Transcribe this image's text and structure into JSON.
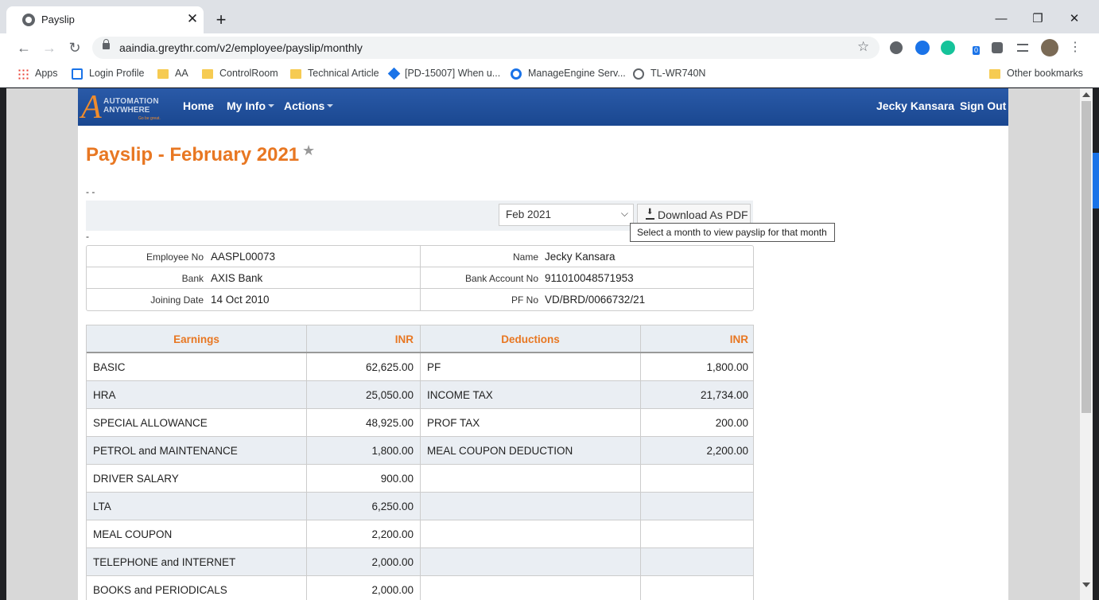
{
  "browser": {
    "tab_title": "Payslip",
    "tab_close": "✕",
    "new_tab": "+",
    "url": "aaindia.greythr.com/v2/employee/payslip/monthly",
    "window_controls": {
      "minimize": "—",
      "restore": "❐",
      "close": "✕"
    },
    "extension_badge": "0",
    "bookmarks": [
      {
        "label": "Apps",
        "icon": "apps-grid-icon"
      },
      {
        "label": "Login Profile",
        "icon": "box-icon"
      },
      {
        "label": "AA",
        "icon": "folder-icon"
      },
      {
        "label": "ControlRoom",
        "icon": "folder-icon"
      },
      {
        "label": "Technical Article",
        "icon": "folder-icon"
      },
      {
        "label": "[PD-15007] When u...",
        "icon": "diamond-icon"
      },
      {
        "label": "ManageEngine Serv...",
        "icon": "ring-icon"
      },
      {
        "label": "TL-WR740N",
        "icon": "globe-icon"
      },
      {
        "label": "Other bookmarks",
        "icon": "folder-icon"
      }
    ]
  },
  "app": {
    "logo": {
      "letter": "A",
      "line1": "AUTOMATION",
      "line2": "ANYWHERE",
      "tagline": "Go be great."
    },
    "nav": {
      "home": "Home",
      "my_info": "My Info",
      "actions": "Actions"
    },
    "user_name": "Jecky Kansara",
    "sign_out": "Sign Out",
    "accent_color": "#e87722",
    "navbar_color": "#1f4f9c"
  },
  "payslip": {
    "title": "Payslip - February 2021",
    "dash1": "- -",
    "dash2": "-",
    "selected_month": "Feb 2021",
    "download_label": "Download As PDF",
    "tooltip": "Select a month to view payslip for that month",
    "employee": {
      "rows": [
        {
          "l_label": "Employee No",
          "l_value": "AASPL00073",
          "r_label": "Name",
          "r_value": "Jecky Kansara"
        },
        {
          "l_label": "Bank",
          "l_value": "AXIS Bank",
          "r_label": "Bank Account No",
          "r_value": "911010048571953"
        },
        {
          "l_label": "Joining Date",
          "l_value": "14 Oct 2010",
          "r_label": "PF No",
          "r_value": "VD/BRD/0066732/21"
        }
      ]
    },
    "table": {
      "headers": {
        "earnings": "Earnings",
        "earn_inr": "INR",
        "deductions": "Deductions",
        "ded_inr": "INR"
      },
      "rows": [
        {
          "earning": "BASIC",
          "earning_amt": "62,625.00",
          "deduction": "PF",
          "deduction_amt": "1,800.00"
        },
        {
          "earning": "HRA",
          "earning_amt": "25,050.00",
          "deduction": "INCOME TAX",
          "deduction_amt": "21,734.00"
        },
        {
          "earning": "SPECIAL ALLOWANCE",
          "earning_amt": "48,925.00",
          "deduction": "PROF TAX",
          "deduction_amt": "200.00"
        },
        {
          "earning": "PETROL and MAINTENANCE",
          "earning_amt": "1,800.00",
          "deduction": "MEAL COUPON DEDUCTION",
          "deduction_amt": "2,200.00"
        },
        {
          "earning": "DRIVER SALARY",
          "earning_amt": "900.00",
          "deduction": "",
          "deduction_amt": ""
        },
        {
          "earning": "LTA",
          "earning_amt": "6,250.00",
          "deduction": "",
          "deduction_amt": ""
        },
        {
          "earning": "MEAL COUPON",
          "earning_amt": "2,200.00",
          "deduction": "",
          "deduction_amt": ""
        },
        {
          "earning": "TELEPHONE and INTERNET",
          "earning_amt": "2,000.00",
          "deduction": "",
          "deduction_amt": ""
        },
        {
          "earning": "BOOKS and PERIODICALS",
          "earning_amt": "2,000.00",
          "deduction": "",
          "deduction_amt": ""
        }
      ]
    }
  }
}
